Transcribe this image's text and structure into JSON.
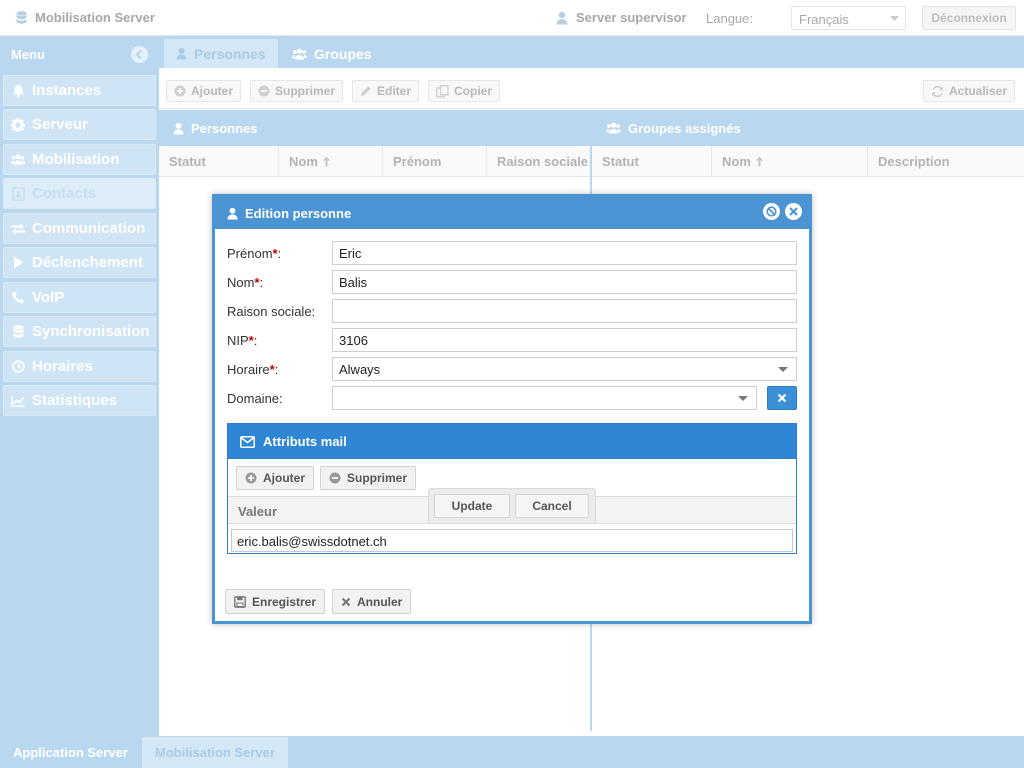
{
  "header": {
    "app_title": "Mobilisation Server",
    "user": "Server supervisor",
    "language_label": "Langue:",
    "language_value": "Français",
    "logout": "Déconnexion"
  },
  "sidebar": {
    "title": "Menu",
    "items": [
      {
        "label": "Instances",
        "icon": "bell-icon"
      },
      {
        "label": "Serveur",
        "icon": "gear-icon"
      },
      {
        "label": "Mobilisation",
        "icon": "users-icon"
      },
      {
        "label": "Contacts",
        "icon": "address-book-icon",
        "active": true
      },
      {
        "label": "Communication",
        "icon": "exchange-icon"
      },
      {
        "label": "Déclenchement",
        "icon": "play-icon"
      },
      {
        "label": "VoIP",
        "icon": "phone-icon"
      },
      {
        "label": "Synchronisation",
        "icon": "database-icon"
      },
      {
        "label": "Horaires",
        "icon": "clock-icon"
      },
      {
        "label": "Statistiques",
        "icon": "chart-line-icon"
      }
    ]
  },
  "tabs": [
    {
      "label": "Personnes",
      "active": true
    },
    {
      "label": "Groupes",
      "active": false
    }
  ],
  "toolbar": {
    "add": "Ajouter",
    "delete": "Supprimer",
    "edit": "Editer",
    "copy": "Copier",
    "refresh": "Actualiser"
  },
  "persons_panel": {
    "title": "Personnes",
    "columns": [
      "Statut",
      "Nom",
      "Prénom",
      "Raison sociale"
    ]
  },
  "groups_panel": {
    "title": "Groupes assignés",
    "columns": [
      "Statut",
      "Nom",
      "Description"
    ]
  },
  "modal": {
    "title": "Edition personne",
    "fields": {
      "prenom": {
        "label": "Prénom",
        "value": "Eric"
      },
      "nom": {
        "label": "Nom",
        "value": "Balis"
      },
      "raison": {
        "label": "Raison sociale:",
        "value": ""
      },
      "nip": {
        "label": "NIP",
        "value": "3106"
      },
      "horaire": {
        "label": "Horaire",
        "value": "Always"
      },
      "domaine": {
        "label": "Domaine:",
        "value": ""
      }
    },
    "required_mark": "*",
    "colon": ":",
    "mail": {
      "title": "Attributs mail",
      "add": "Ajouter",
      "delete": "Supprimer",
      "column": "Valeur",
      "editor_value": "eric.balis@swissdotnet.ch",
      "update": "Update",
      "cancel": "Cancel"
    },
    "save": "Enregistrer",
    "cancel": "Annuler"
  },
  "bottom_tabs": [
    {
      "label": "Application Server",
      "active": false
    },
    {
      "label": "Mobilisation Server",
      "active": true
    }
  ],
  "colors": {
    "accent": "#4a94d4",
    "sidebar": "#b9d8ef",
    "mail_header": "#2f86d4",
    "required": "#c00000"
  }
}
